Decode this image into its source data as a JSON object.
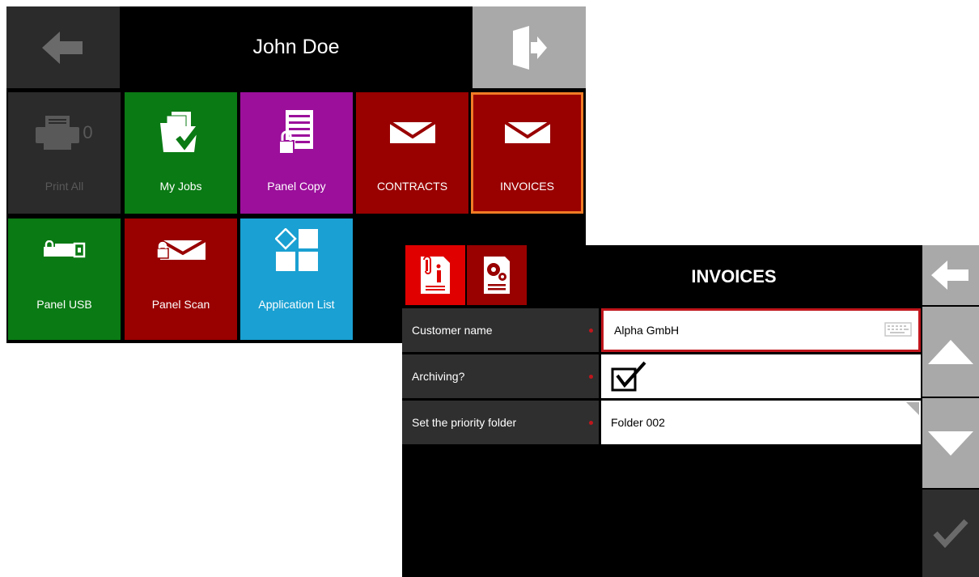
{
  "home": {
    "user_name": "John Doe",
    "tiles": [
      {
        "label": "Print All",
        "count": "0",
        "color": "#2b2b2b",
        "icon": "printer-icon"
      },
      {
        "label": "My Jobs",
        "color": "#0a7a14",
        "icon": "folder-check-icon"
      },
      {
        "label": "Panel Copy",
        "color": "#9b0f9b",
        "icon": "locked-document-icon"
      },
      {
        "label": "CONTRACTS",
        "color": "#990000",
        "icon": "envelope-icon"
      },
      {
        "label": "INVOICES",
        "color": "#990000",
        "icon": "envelope-icon",
        "selected": true,
        "border_color": "#f07c25"
      },
      {
        "label": "Panel USB",
        "color": "#0a7a14",
        "icon": "usb-lock-icon"
      },
      {
        "label": "Panel Scan",
        "color": "#990000",
        "icon": "envelope-lock-icon"
      },
      {
        "label": "Application List",
        "color": "#1aa0d2",
        "icon": "app-grid-icon"
      }
    ]
  },
  "form": {
    "title": "INVOICES",
    "tabs": [
      {
        "icon": "document-info-icon",
        "active": true,
        "color": "#e00000"
      },
      {
        "icon": "document-settings-icon",
        "active": false,
        "color": "#990000"
      }
    ],
    "fields": [
      {
        "label": "Customer name",
        "value": "Alpha GmbH",
        "type": "text",
        "focused": true,
        "focus_color": "#c0161c"
      },
      {
        "label": "Archiving?",
        "checked": true,
        "type": "checkbox"
      },
      {
        "label": "Set the priority folder",
        "value": "Folder 002",
        "type": "select"
      }
    ],
    "side_buttons": [
      "back-arrow-icon",
      "scroll-up-icon",
      "scroll-down-icon",
      "confirm-check-icon"
    ]
  }
}
